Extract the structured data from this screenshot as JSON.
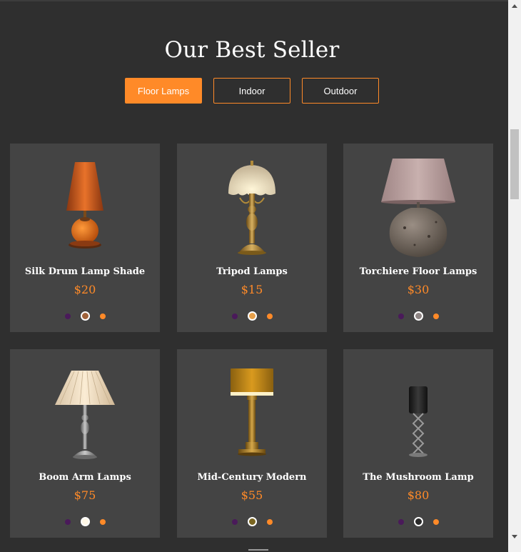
{
  "section_title": "Our Best Seller",
  "tabs": [
    {
      "label": "Floor Lamps",
      "active": true
    },
    {
      "label": "Indoor",
      "active": false
    },
    {
      "label": "Outdoor",
      "active": false
    }
  ],
  "products": [
    {
      "name": "Silk Drum Lamp Shade",
      "price": "$20",
      "icon": "orange-cone-lamp-image",
      "swatches": [
        "#4a1a5a",
        "#a0623a",
        "#ff8a28"
      ],
      "selected_swatch": 1
    },
    {
      "name": "Tripod Lamps",
      "price": "$15",
      "icon": "brass-dome-lamp-image",
      "swatches": [
        "#4a1a5a",
        "#e7a04a",
        "#ff8a28"
      ],
      "selected_swatch": 1
    },
    {
      "name": "Torchiere Floor Lamps",
      "price": "$30",
      "icon": "stone-pot-lamp-image",
      "swatches": [
        "#4a1a5a",
        "#8e8584",
        "#ff8a28"
      ],
      "selected_swatch": 1
    },
    {
      "name": "Boom Arm Lamps",
      "price": "$75",
      "icon": "pleated-shade-lamp-image",
      "swatches": [
        "#4a1a5a",
        "#fff8e6",
        "#ff8a28"
      ],
      "selected_swatch": 1
    },
    {
      "name": "Mid-Century Modern",
      "price": "$55",
      "icon": "gold-drum-lamp-image",
      "swatches": [
        "#4a1a5a",
        "#7a6520",
        "#ff8a28"
      ],
      "selected_swatch": 1
    },
    {
      "name": "The Mushroom Lamp",
      "price": "$80",
      "icon": "black-shade-lamp-image",
      "swatches": [
        "#4a1a5a",
        "#2a2a2a",
        "#ff8a28"
      ],
      "selected_swatch": 1
    }
  ],
  "colors": {
    "accent": "#ff8a28",
    "background": "#2f2f2f",
    "card": "#444444"
  }
}
